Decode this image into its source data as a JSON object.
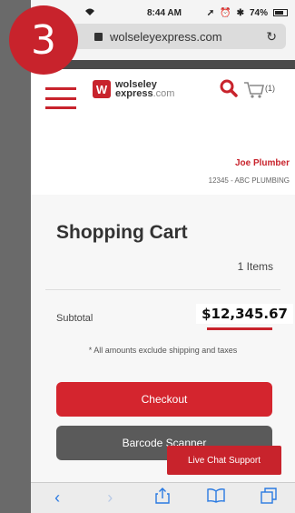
{
  "step_badge": "3",
  "status_bar": {
    "time": "8:44 AM",
    "battery": "74%",
    "battery_level": 0.74
  },
  "browser": {
    "url": "wolseleyexpress.com",
    "reload_icon": "reload-icon",
    "lock_icon": "lock-icon"
  },
  "header": {
    "logo_mark": "W",
    "logo_line1": "wolseley",
    "logo_line2": "express",
    "logo_suffix": ".com",
    "cart_count": "(1)",
    "user_name": "Joe Plumber",
    "account": "12345 - ABC PLUMBING"
  },
  "cart": {
    "title": "Shopping Cart",
    "items": "1 Items",
    "subtotal_label": "Subtotal",
    "subtotal_value": "$12,345.67",
    "note": "* All amounts exclude shipping and taxes",
    "checkout_label": "Checkout",
    "barcode_label": "Barcode Scanner",
    "live_chat_label": "Live Chat Support"
  },
  "colors": {
    "brand_red": "#c8232c",
    "dark_button": "#5a5a5a",
    "ios_blue": "#2a7ae2"
  }
}
